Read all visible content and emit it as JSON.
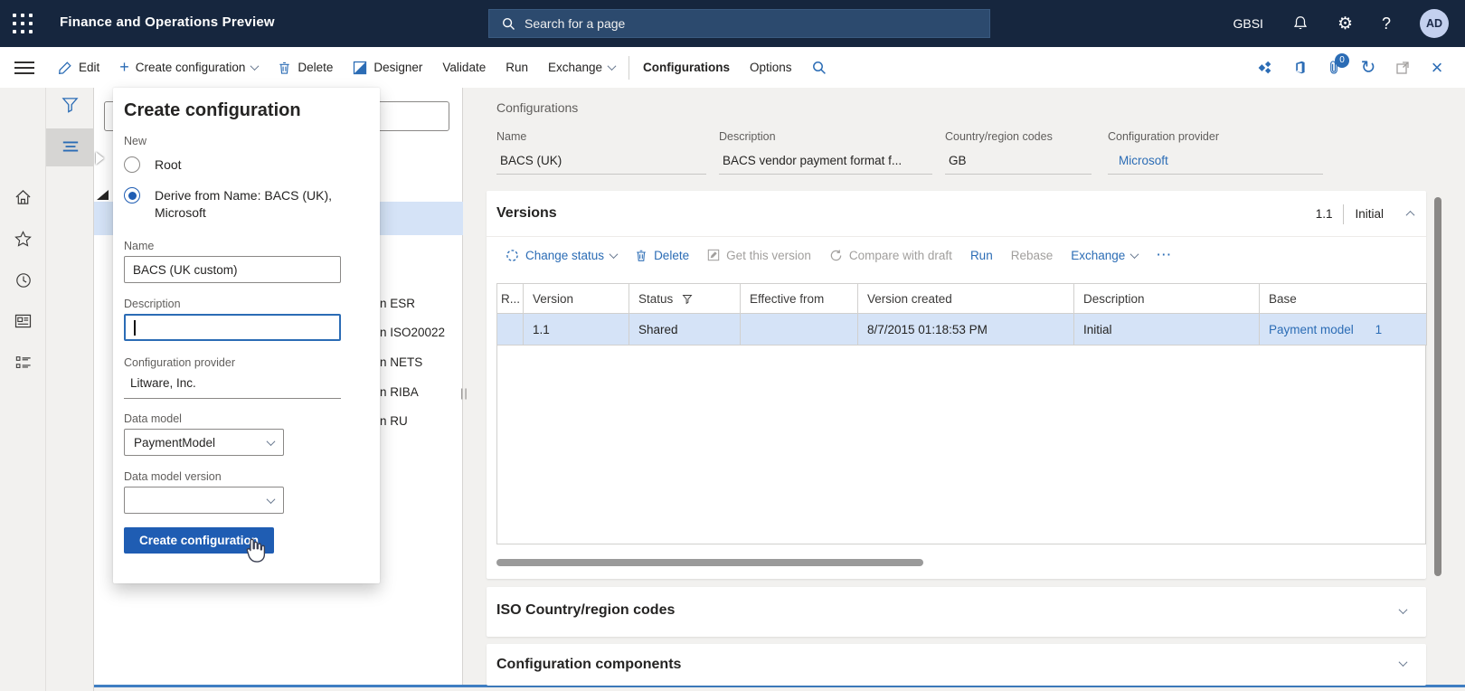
{
  "topbar": {
    "title": "Finance and Operations Preview",
    "search_placeholder": "Search for a page",
    "company": "GBSI",
    "help_glyph": "?",
    "gear_glyph": "⚙",
    "avatar_initials": "AD"
  },
  "actionbar": {
    "edit": "Edit",
    "plus_glyph": "+",
    "create_configuration": "Create configuration",
    "delete": "Delete",
    "designer": "Designer",
    "validate": "Validate",
    "run": "Run",
    "exchange": "Exchange",
    "configurations": "Configurations",
    "options": "Options",
    "attachments_badge": "0",
    "refresh_glyph": "↻",
    "close_glyph": "×"
  },
  "flyout": {
    "title": "Create configuration",
    "group_label": "New",
    "radio_root_label": "Root",
    "radio_derive_label": "Derive from Name: BACS (UK), Microsoft",
    "name_label": "Name",
    "name_value": "BACS (UK custom)",
    "description_label": "Description",
    "description_value": "",
    "provider_label": "Configuration provider",
    "provider_value": "Litware, Inc.",
    "data_model_label": "Data model",
    "data_model_value": "PaymentModel",
    "data_model_version_label": "Data model version",
    "data_model_version_value": "",
    "submit_label": "Create configuration"
  },
  "tree": {
    "items": [
      "n ESR",
      "n ISO20022",
      "n NETS",
      "n RIBA",
      "n RU"
    ],
    "splitter_glyph": "||"
  },
  "main": {
    "caption": "Configurations",
    "fields": [
      {
        "label": "Name",
        "value": "BACS (UK)"
      },
      {
        "label": "Description",
        "value": "BACS vendor payment format f..."
      },
      {
        "label": "Country/region codes",
        "value": "GB"
      },
      {
        "label": "Configuration provider",
        "value": "Microsoft"
      }
    ],
    "versions": {
      "title": "Versions",
      "current_version": "1.1",
      "current_status": "Initial",
      "toolbar": [
        {
          "label": "Change status"
        },
        {
          "label": "Delete"
        },
        {
          "label": "Get this version"
        },
        {
          "label": "Compare with draft"
        },
        {
          "label": "Run"
        },
        {
          "label": "Rebase"
        },
        {
          "label": "Exchange"
        },
        {
          "label": "⋯"
        }
      ],
      "table": {
        "columns": [
          "R...",
          "Version",
          "Status",
          "Effective from",
          "Version created",
          "Description",
          "Base"
        ],
        "rows": [
          {
            "version": "1.1",
            "status": "Shared",
            "effective_from": "",
            "version_created": "8/7/2015 01:18:53 PM",
            "description": "Initial",
            "base": "Payment model",
            "base_extra": "1"
          }
        ]
      }
    },
    "sections": [
      {
        "title": "ISO Country/region codes"
      },
      {
        "title": "Configuration components"
      }
    ],
    "colors": {
      "accent_blue": "#2b6cb5",
      "primary_button": "#1f5db3",
      "topbar": "#16263e",
      "selected_row": "#d5e3f7"
    }
  }
}
